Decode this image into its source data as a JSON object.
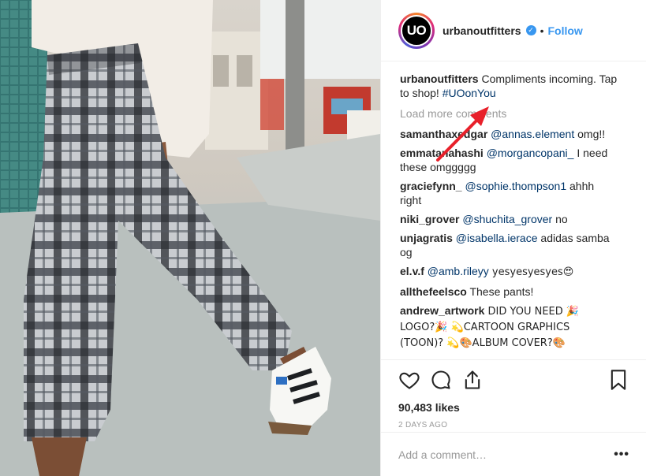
{
  "post": {
    "username": "urbanoutfitters",
    "avatar_text": "UO",
    "verified_mark": "✓",
    "dot": "•",
    "follow_label": "Follow",
    "caption": {
      "username": "urbanoutfitters",
      "text": " Compliments incoming. Tap to shop! ",
      "hashtag": "#UOonYou"
    },
    "load_more_label": "Load more comments",
    "comments": [
      {
        "user": "samanthaxedgar",
        "mention": "@annas.element",
        "text": " omg!!"
      },
      {
        "user": "emmatanahashi",
        "mention": "@morgancopani_",
        "text": " I need these omggggg"
      },
      {
        "user": "graciefynn_",
        "mention": "@sophie.thompson1",
        "text": " ahhh right"
      },
      {
        "user": "niki_grover",
        "mention": "@shuchita_grover",
        "text": " no"
      },
      {
        "user": "unjagratis",
        "mention": "@isabella.ierace",
        "text": " adidas samba og"
      },
      {
        "user": "el.v.f",
        "mention": "@amb.rileyy",
        "text": " yesyesyesyes😍"
      },
      {
        "user": "allthefeelsco",
        "mention": "",
        "text": " These pants!"
      },
      {
        "user": "andrew_artwork",
        "mention": "",
        "text": " DID YOU NEED 🎉 LOGO?🎉 💫CARTOON GRAPHICS (TOON)? 💫🎨ALBUM COVER?🎨"
      }
    ],
    "likes": "90,483 likes",
    "time_ago": "2 DAYS AGO",
    "add_comment_placeholder": "Add a comment…",
    "more_options": "•••"
  },
  "colors": {
    "link": "#3897f0",
    "mention": "#003569",
    "annotation_arrow": "#e8202a"
  },
  "icons": [
    "heart-icon",
    "comment-icon",
    "share-icon",
    "bookmark-icon",
    "more-options-icon"
  ]
}
